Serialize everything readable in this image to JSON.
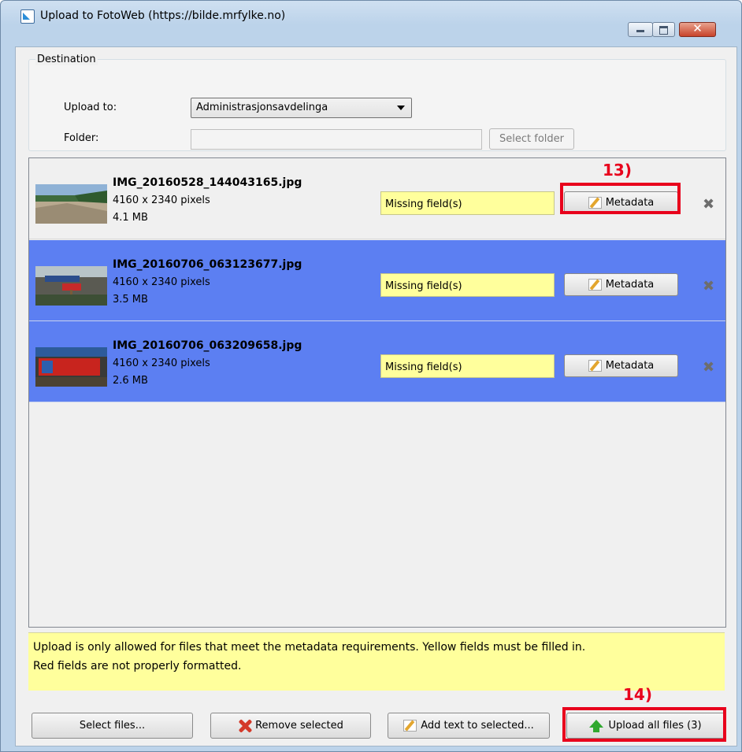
{
  "window": {
    "title": "Upload to FotoWeb (https://bilde.mrfylke.no)",
    "close_glyph": "✕"
  },
  "destination": {
    "group_label": "Destination",
    "upload_to_label": "Upload to:",
    "upload_to_value": "Administrasjonsavdelinga",
    "folder_label": "Folder:",
    "folder_value": "",
    "select_folder_label": "Select folder"
  },
  "files": [
    {
      "name": "IMG_20160528_144043165.jpg",
      "dimensions": "4160 x 2340 pixels",
      "size": "4.1 MB",
      "status": "Missing field(s)",
      "metadata_label": "Metadata",
      "remove_glyph": "✖",
      "selected": false
    },
    {
      "name": "IMG_20160706_063123677.jpg",
      "dimensions": "4160 x 2340 pixels",
      "size": "3.5 MB",
      "status": "Missing field(s)",
      "metadata_label": "Metadata",
      "remove_glyph": "✖",
      "selected": true
    },
    {
      "name": "IMG_20160706_063209658.jpg",
      "dimensions": "4160 x 2340 pixels",
      "size": "2.6 MB",
      "status": "Missing field(s)",
      "metadata_label": "Metadata",
      "remove_glyph": "✖",
      "selected": true
    }
  ],
  "info_text": {
    "line1": "Upload is only allowed for files that meet the metadata requirements. Yellow fields must be filled in.",
    "line2": "Red fields are not properly formatted."
  },
  "footer": {
    "select_files": "Select files...",
    "remove_selected": "Remove selected",
    "add_text": "Add text to selected...",
    "upload_all": "Upload all files (3)"
  },
  "annotations": {
    "step13": "13)",
    "step14": "14)"
  },
  "colors": {
    "selected_row": "#5c7ff2",
    "missing_field": "#ffff9c",
    "annotation_red": "#e8001c"
  }
}
